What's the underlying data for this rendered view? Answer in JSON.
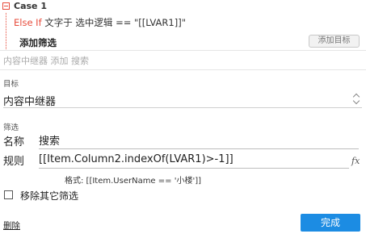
{
  "case": {
    "title": "Case 1",
    "condition_keyword": "Else If",
    "condition_text": " 文字于 选中逻辑 == \"[[LVAR1]]\"",
    "add_filter_label": "添加筛选",
    "add_target_label": "添加目标"
  },
  "summary": "内容中继器 添加 搜索",
  "target": {
    "section_label": "目标",
    "value": "内容中继器"
  },
  "filter": {
    "section_label": "筛选",
    "name_label": "名称",
    "name_value": "搜索",
    "rule_label": "规则",
    "rule_value": "[[Item.Column2.indexOf(LVAR1)>-1]]",
    "fx_label": "fx",
    "format_hint": "格式: [[Item.UserName == '小楼']]"
  },
  "remove_others": {
    "label": "移除其它筛选",
    "checked": false
  },
  "footer": {
    "delete_label": "删除",
    "done_label": "完成"
  },
  "colors": {
    "accent": "#1c8ce3",
    "keyword_red": "#e74c3c"
  }
}
